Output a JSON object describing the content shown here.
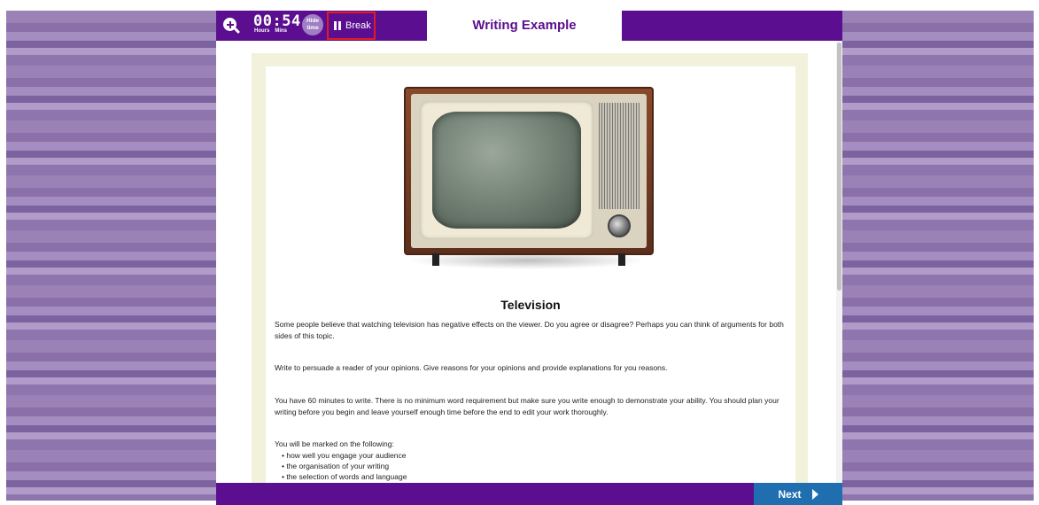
{
  "topbar": {
    "timer": {
      "value": "00:54",
      "hours_label": "Hours",
      "mins_label": "Mins"
    },
    "hide_time_label_1": "Hide",
    "hide_time_label_2": "time",
    "break_label": "Break",
    "title": "Writing Example"
  },
  "content": {
    "heading": "Television",
    "paragraphs": [
      "Some people believe that watching television has negative effects on the viewer. Do you agree or disagree? Perhaps you can think of arguments for both sides of this topic.",
      "Write to persuade a reader of your opinions. Give reasons for your opinions and provide explanations for you reasons.",
      "You have 60 minutes to write. There is no minimum word requirement but make sure you write enough to demonstrate your ability. You should plan your writing before you begin and leave yourself enough time before the end to edit your work thoroughly.",
      "You will be marked on the following:"
    ],
    "bullets": [
      "• how well you engage your audience",
      "• the organisation of your writing",
      "• the selection of words and language"
    ]
  },
  "footer": {
    "next_label": "Next"
  },
  "icons": {
    "zoom": "zoom-in-icon",
    "pause": "pause-icon",
    "next": "play-arrow-icon"
  },
  "colors": {
    "brand_purple": "#5b0e8f",
    "next_blue": "#1f6fb0",
    "highlight_red": "#e01b24"
  }
}
